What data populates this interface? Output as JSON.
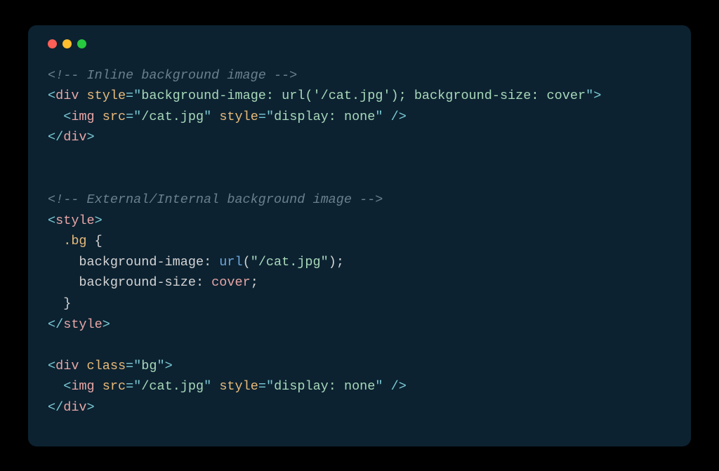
{
  "code": {
    "comment1": "<!-- Inline background image -->",
    "line2": {
      "open_bracket": "<",
      "tag": "div",
      "attr": "style",
      "eq": "=",
      "q1": "\"",
      "val": "background-image: url('/cat.jpg'); background-size: cover",
      "q2": "\"",
      "close_bracket": ">"
    },
    "line3": {
      "indent": "  ",
      "open_bracket": "<",
      "tag": "img",
      "attr1": "src",
      "eq": "=",
      "q1": "\"",
      "val1": "/cat.jpg",
      "q2": "\"",
      "attr2": "style",
      "q3": "\"",
      "val2": "display: none",
      "q4": "\"",
      "slash": " />",
      "close": ""
    },
    "line4": {
      "open_bracket": "</",
      "tag": "div",
      "close_bracket": ">"
    },
    "comment2": "<!-- External/Internal background image -->",
    "line7": {
      "open_bracket": "<",
      "tag": "style",
      "close_bracket": ">"
    },
    "line8": {
      "indent": "  ",
      "selector": ".bg",
      "brace": " {"
    },
    "line9": {
      "indent": "    ",
      "prop": "background-image",
      "colon": ": ",
      "func": "url",
      "paren_open": "(",
      "q1": "\"",
      "arg": "/cat.jpg",
      "q2": "\"",
      "paren_close": ")",
      "semi": ";"
    },
    "line10": {
      "indent": "    ",
      "prop": "background-size",
      "colon": ": ",
      "val": "cover",
      "semi": ";"
    },
    "line11": {
      "indent": "  ",
      "brace": "}"
    },
    "line12": {
      "open_bracket": "</",
      "tag": "style",
      "close_bracket": ">"
    },
    "line14": {
      "open_bracket": "<",
      "tag": "div",
      "attr": "class",
      "eq": "=",
      "q1": "\"",
      "val": "bg",
      "q2": "\"",
      "close_bracket": ">"
    },
    "line15": {
      "indent": "  ",
      "open_bracket": "<",
      "tag": "img",
      "attr1": "src",
      "eq": "=",
      "q1": "\"",
      "val1": "/cat.jpg",
      "q2": "\"",
      "attr2": "style",
      "q3": "\"",
      "val2": "display: none",
      "q4": "\"",
      "slash": " />"
    },
    "line16": {
      "open_bracket": "</",
      "tag": "div",
      "close_bracket": ">"
    }
  }
}
